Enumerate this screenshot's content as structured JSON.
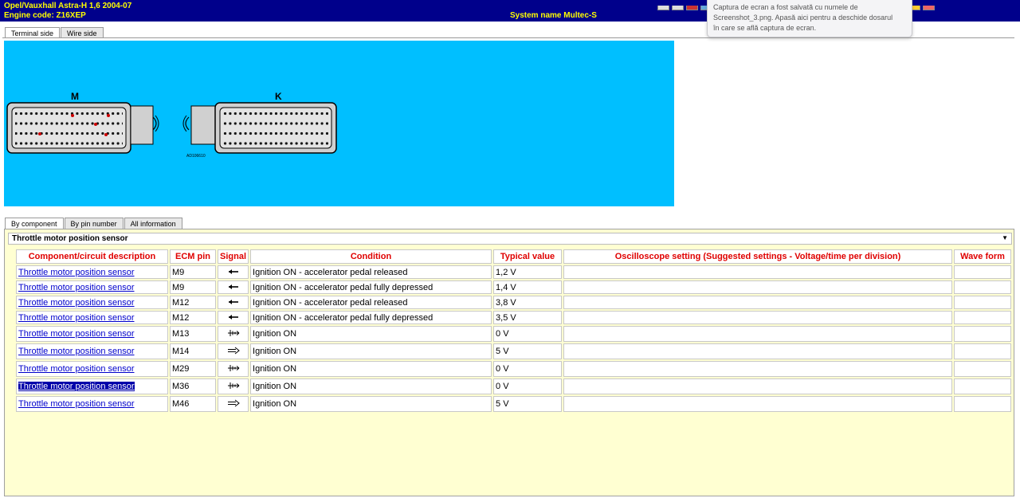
{
  "header": {
    "vehicle": "Opel/Vauxhall  Astra-H  1,6  2004-07",
    "engine": "Engine code: Z16XEP",
    "system": "System name Multec-S"
  },
  "toast": {
    "line1": "Captura de ecran a fost salvată cu numele de",
    "line2": "Screenshot_3.png. Apasă aici pentru a deschide dosarul",
    "line3": "în care se află captura de ecran."
  },
  "view_tabs": [
    "Terminal side",
    "Wire side"
  ],
  "diagram": {
    "connector_m": "M",
    "connector_k": "K",
    "ref": "AD106610",
    "accent": "#00bfff"
  },
  "info_tabs": [
    "By component",
    "By pin number",
    "All information"
  ],
  "selected_component": "Throttle motor position sensor",
  "columns": [
    "Component/circuit description",
    "ECM pin",
    "Signal",
    "Condition",
    "Typical value",
    "Oscilloscope setting (Suggested settings - Voltage/time per division)",
    "Wave form"
  ],
  "rows": [
    {
      "desc": "Throttle motor position sensor",
      "pin": "M9",
      "signal": "arrow-left-icon",
      "condition": "Ignition ON - accelerator pedal released",
      "value": "1,2 V",
      "osc": "",
      "wave": ""
    },
    {
      "desc": "Throttle motor position sensor",
      "pin": "M9",
      "signal": "arrow-left-icon",
      "condition": "Ignition ON - accelerator pedal fully depressed",
      "value": "1,4 V",
      "osc": "",
      "wave": ""
    },
    {
      "desc": "Throttle motor position sensor",
      "pin": "M12",
      "signal": "arrow-left-icon",
      "condition": "Ignition ON - accelerator pedal released",
      "value": "3,8 V",
      "osc": "",
      "wave": ""
    },
    {
      "desc": "Throttle motor position sensor",
      "pin": "M12",
      "signal": "arrow-left-icon",
      "condition": "Ignition ON - accelerator pedal fully depressed",
      "value": "3,5 V",
      "osc": "",
      "wave": ""
    },
    {
      "desc": "Throttle motor position sensor",
      "pin": "M13",
      "signal": "ground-icon",
      "condition": "Ignition ON",
      "value": "0 V",
      "osc": "",
      "wave": ""
    },
    {
      "desc": "Throttle motor position sensor",
      "pin": "M14",
      "signal": "supply-arrow-icon",
      "condition": "Ignition ON",
      "value": "5 V",
      "osc": "",
      "wave": ""
    },
    {
      "desc": "Throttle motor position sensor",
      "pin": "M29",
      "signal": "ground-icon",
      "condition": "Ignition ON",
      "value": "0 V",
      "osc": "",
      "wave": ""
    },
    {
      "desc": "Throttle motor position sensor",
      "pin": "M36",
      "signal": "ground-icon",
      "condition": "Ignition ON",
      "value": "0 V",
      "osc": "",
      "wave": "",
      "selected": true
    },
    {
      "desc": "Throttle motor position sensor",
      "pin": "M46",
      "signal": "supply-arrow-icon",
      "condition": "Ignition ON",
      "value": "5 V",
      "osc": "",
      "wave": ""
    }
  ]
}
